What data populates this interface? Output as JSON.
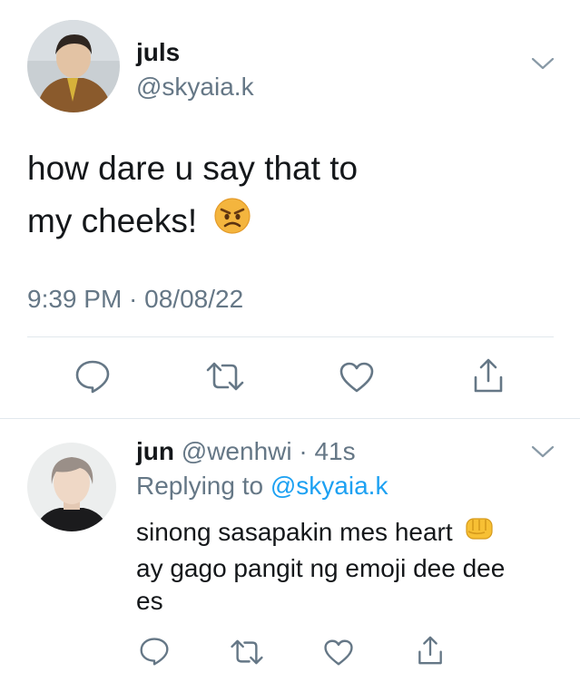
{
  "tweet": {
    "author_name": "juls",
    "author_handle": "@skyaia.k",
    "text_line1": "how dare u say that to",
    "text_line2": "my cheeks!",
    "text_emoji": "angry-face-emoji",
    "timestamp": "9:39 PM · 08/08/22",
    "actions": [
      "reply-icon",
      "retweet-icon",
      "like-icon",
      "share-icon"
    ]
  },
  "reply": {
    "author_name": "jun",
    "author_handle": "@wenhwi",
    "separator": " · ",
    "time_ago": "41s",
    "replying_prefix": "Replying to ",
    "replying_to": "@skyaia.k",
    "text_line1": "sinong sasapakin mes heart",
    "text_emoji": "oncoming-fist-emoji",
    "text_line2": "ay gago pangit ng emoji dee dee",
    "text_line3": "es",
    "actions": [
      "reply-icon",
      "retweet-icon",
      "like-icon",
      "share-icon"
    ]
  },
  "colors": {
    "text": "#14171a",
    "muted": "#657786",
    "link": "#1da1f2",
    "divider": "#e1e8ed"
  }
}
